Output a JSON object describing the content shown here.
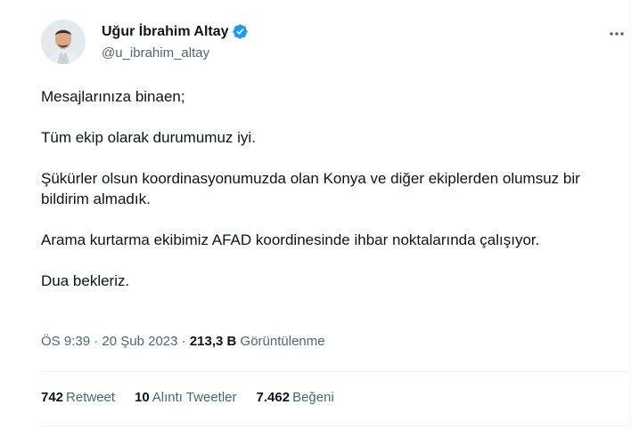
{
  "author": {
    "name": "Uğur İbrahim Altay",
    "handle": "@u_ibrahim_altay",
    "verified_color": "#1d9bf0"
  },
  "tweet": {
    "paragraphs": [
      "Mesajlarınıza binaen;",
      "Tüm ekip olarak durumumuz iyi.",
      "Şükürler olsun koordinasyonumuzda olan Konya ve diğer ekiplerden olumsuz bir bildirim almadık.",
      "Arama kurtarma ekibimiz AFAD koordinesinde ihbar noktalarında çalışıyor.",
      "Dua bekleriz."
    ]
  },
  "meta": {
    "time": "ÖS 9:39",
    "date": "20 Şub 2023",
    "views_count": "213,3 B",
    "views_label": "Görüntülenme",
    "separator": "·"
  },
  "stats": {
    "retweets": {
      "count": "742",
      "label": "Retweet"
    },
    "quotes": {
      "count": "10",
      "label": "Alıntı Tweetler"
    },
    "likes": {
      "count": "7.462",
      "label": "Beğeni"
    }
  },
  "more_icon": "more-horizontal-icon",
  "colors": {
    "text": "#0f1419",
    "secondary": "#536471",
    "border": "#eff3f4"
  }
}
